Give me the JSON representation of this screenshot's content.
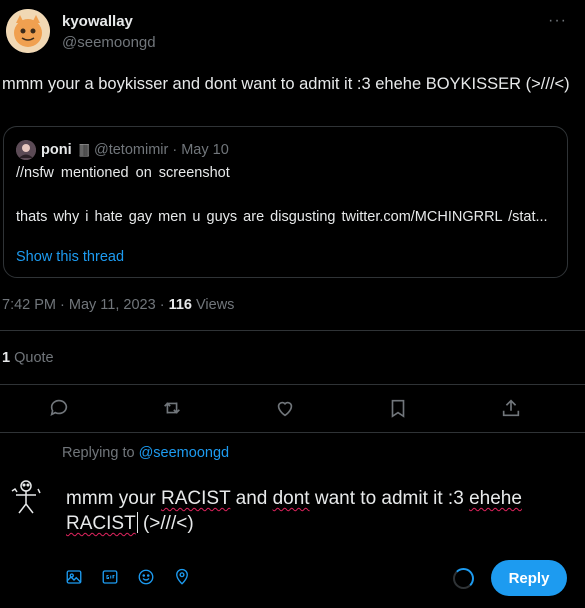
{
  "author": {
    "name": "kyowallay",
    "handle": "@seemoongd"
  },
  "tweet": {
    "text": "mmm your a boykisser and dont want to admit it :3 ehehe BOYKISSER (>///<)"
  },
  "quote": {
    "name": "poni",
    "badge": "🀫",
    "meta": "@tetomimir · May 10",
    "line1": "//nsfw  mentioned  on  screenshot",
    "line2": "thats  why  i  hate  gay  men  u  guys  are  disgusting twitter.com/MCHINGRRL /stat...",
    "show_thread": "Show this thread"
  },
  "meta": {
    "time_date": "7:42 PM · May 11, 2023 · ",
    "views_count": "116",
    "views_label": " Views"
  },
  "quotes": {
    "count": "1",
    "label": " Quote"
  },
  "actions": [
    "reply-icon",
    "retweet-icon",
    "like-icon",
    "bookmark-icon",
    "share-icon"
  ],
  "reply": {
    "replying_prefix": "Replying to ",
    "replying_to": "@seemoongd",
    "text_parts": [
      "mmm your ",
      "RACIST",
      " and ",
      "dont",
      " want to admit it :3 ",
      "ehehe",
      " ",
      "RACIST",
      " (>///<)"
    ],
    "tools": [
      "image-icon",
      "gif-icon",
      "emoji-icon",
      "location-icon"
    ],
    "button": "Reply"
  },
  "colors": {
    "accent": "#1d9bf0",
    "background": "#000000",
    "muted": "#71767b",
    "border": "#2f3336"
  }
}
